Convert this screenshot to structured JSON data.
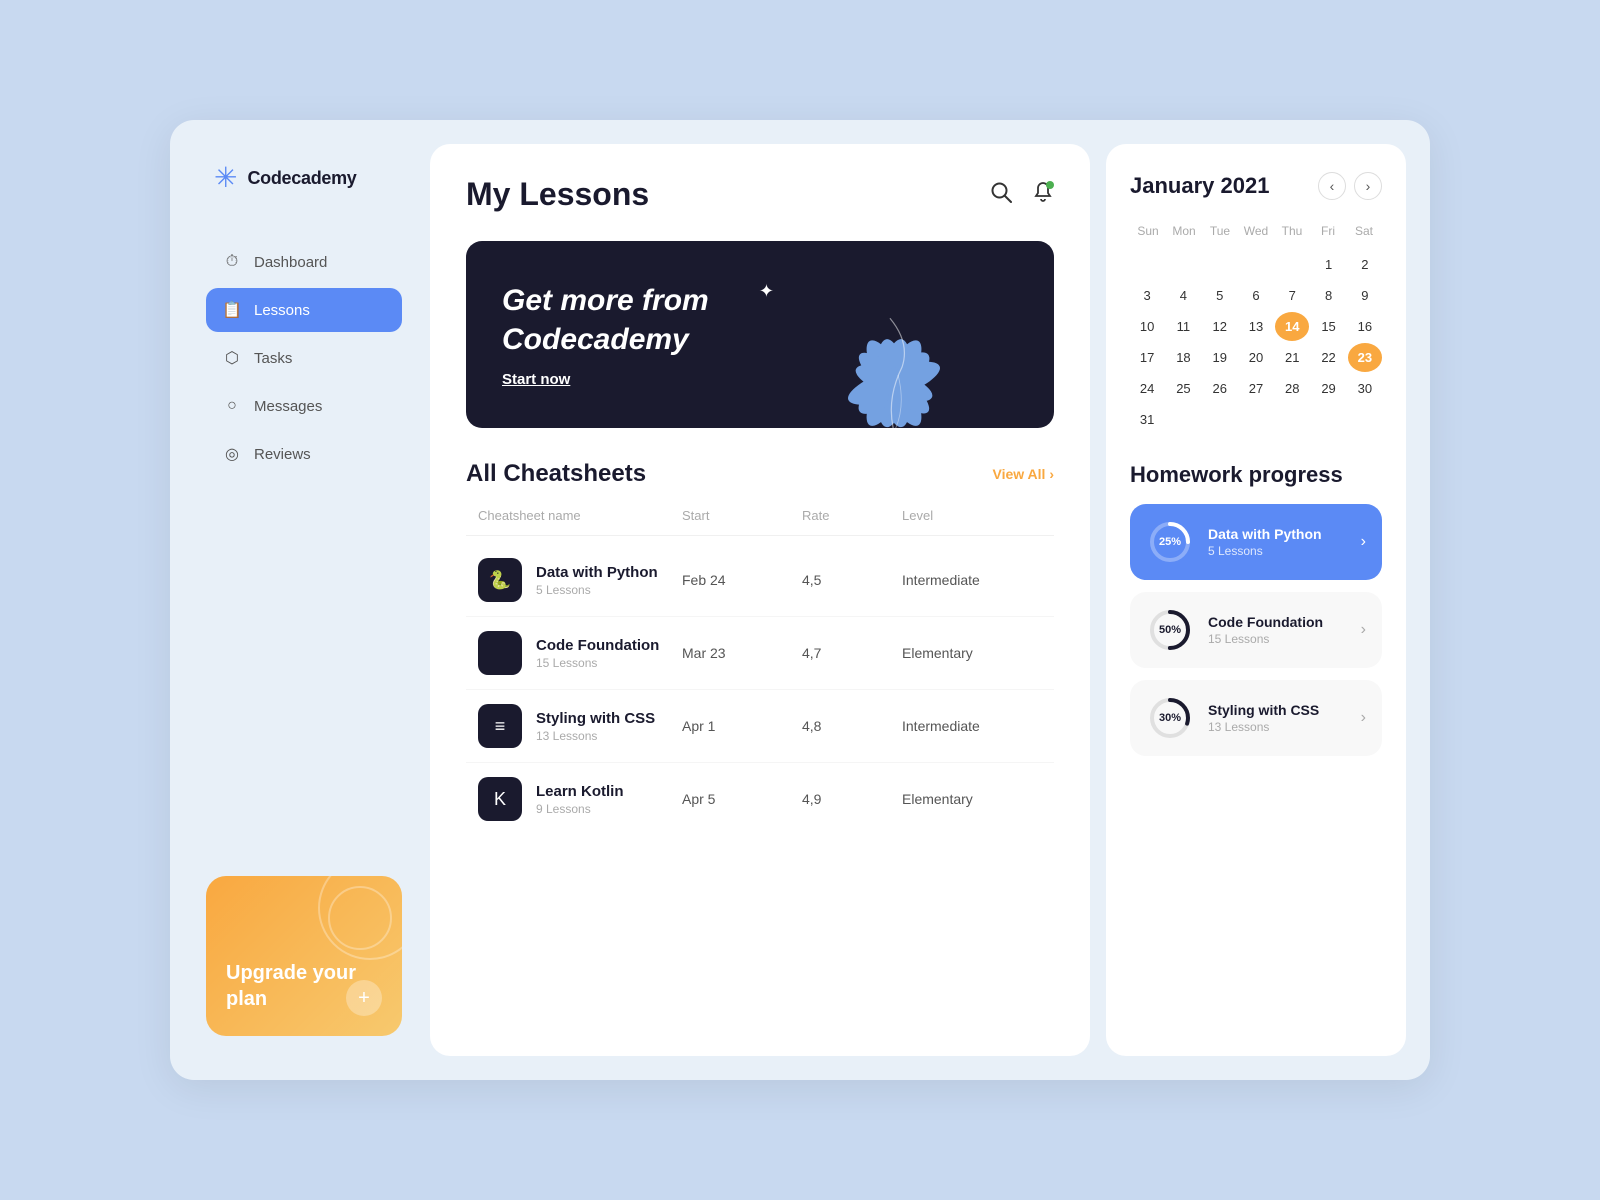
{
  "app": {
    "name": "Codecademy"
  },
  "sidebar": {
    "nav_items": [
      {
        "id": "dashboard",
        "label": "Dashboard",
        "icon": "⏱",
        "active": false
      },
      {
        "id": "lessons",
        "label": "Lessons",
        "icon": "📋",
        "active": true
      },
      {
        "id": "tasks",
        "label": "Tasks",
        "icon": "⬡",
        "active": false
      },
      {
        "id": "messages",
        "label": "Messages",
        "icon": "○",
        "active": false
      },
      {
        "id": "reviews",
        "label": "Reviews",
        "icon": "◎",
        "active": false
      }
    ],
    "upgrade": {
      "text": "Upgrade your plan",
      "button_label": "+"
    }
  },
  "main": {
    "title": "My Lessons",
    "promo": {
      "heading_line1": "Get more from",
      "heading_line2": "Codecademy",
      "cta": "Start now"
    },
    "cheatsheets": {
      "section_title": "All Cheatsheets",
      "view_all": "View All",
      "columns": [
        "Cheatsheet name",
        "Start",
        "Rate",
        "Level"
      ],
      "rows": [
        {
          "id": 1,
          "icon": "🐍",
          "name": "Data with Python",
          "lessons": "5 Lessons",
          "start": "Feb 24",
          "rate": "4,5",
          "level": "Intermediate"
        },
        {
          "id": 2,
          "icon": "</>",
          "name": "Code Foundation",
          "lessons": "15 Lessons",
          "start": "Mar 23",
          "rate": "4,7",
          "level": "Elementary"
        },
        {
          "id": 3,
          "icon": "≡",
          "name": "Styling with CSS",
          "lessons": "13 Lessons",
          "start": "Apr 1",
          "rate": "4,8",
          "level": "Intermediate"
        },
        {
          "id": 4,
          "icon": "K",
          "name": "Learn Kotlin",
          "lessons": "9 Lessons",
          "start": "Apr 5",
          "rate": "4,9",
          "level": "Elementary"
        }
      ]
    }
  },
  "calendar": {
    "title": "January 2021",
    "weekdays": [
      "Sun",
      "Mon",
      "Tue",
      "Wed",
      "Thu",
      "Fri",
      "Sat"
    ],
    "cells": [
      {
        "num": "",
        "state": "empty"
      },
      {
        "num": "",
        "state": "empty"
      },
      {
        "num": "",
        "state": "empty"
      },
      {
        "num": "",
        "state": "empty"
      },
      {
        "num": "",
        "state": "empty"
      },
      {
        "num": "1",
        "state": ""
      },
      {
        "num": "2",
        "state": ""
      },
      {
        "num": "3",
        "state": ""
      },
      {
        "num": "4",
        "state": ""
      },
      {
        "num": "5",
        "state": ""
      },
      {
        "num": "6",
        "state": ""
      },
      {
        "num": "7",
        "state": ""
      },
      {
        "num": "8",
        "state": ""
      },
      {
        "num": "9",
        "state": ""
      },
      {
        "num": "10",
        "state": ""
      },
      {
        "num": "11",
        "state": ""
      },
      {
        "num": "12",
        "state": ""
      },
      {
        "num": "13",
        "state": ""
      },
      {
        "num": "14",
        "state": "today"
      },
      {
        "num": "15",
        "state": ""
      },
      {
        "num": "16",
        "state": ""
      },
      {
        "num": "17",
        "state": ""
      },
      {
        "num": "18",
        "state": ""
      },
      {
        "num": "19",
        "state": ""
      },
      {
        "num": "20",
        "state": ""
      },
      {
        "num": "21",
        "state": ""
      },
      {
        "num": "22",
        "state": ""
      },
      {
        "num": "23",
        "state": "selected"
      },
      {
        "num": "24",
        "state": ""
      },
      {
        "num": "25",
        "state": ""
      },
      {
        "num": "26",
        "state": ""
      },
      {
        "num": "27",
        "state": ""
      },
      {
        "num": "28",
        "state": ""
      },
      {
        "num": "29",
        "state": ""
      },
      {
        "num": "30",
        "state": ""
      },
      {
        "num": "31",
        "state": ""
      }
    ]
  },
  "homework": {
    "title": "Homework progress",
    "items": [
      {
        "id": 1,
        "name": "Data with Python",
        "lessons": "5 Lessons",
        "progress": 25,
        "active": true
      },
      {
        "id": 2,
        "name": "Code Foundation",
        "lessons": "15 Lessons",
        "progress": 50,
        "active": false
      },
      {
        "id": 3,
        "name": "Styling with CSS",
        "lessons": "13 Lessons",
        "progress": 30,
        "active": false
      }
    ]
  }
}
